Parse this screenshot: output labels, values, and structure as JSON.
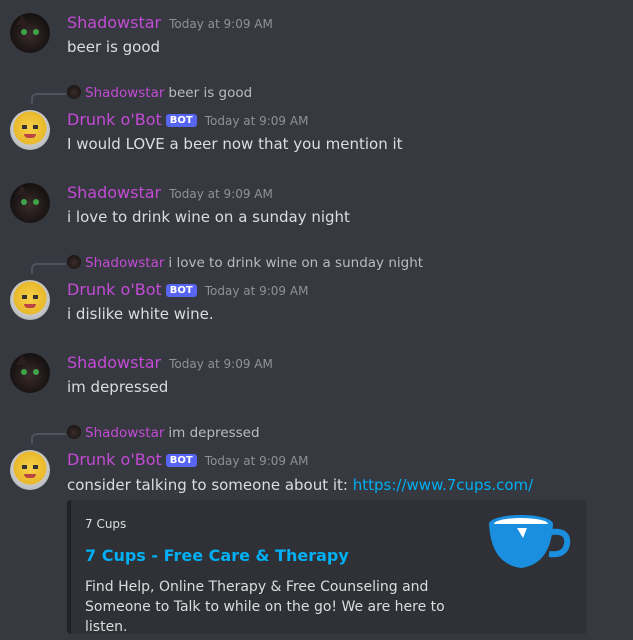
{
  "messages": [
    {
      "author": "Shadowstar",
      "timestamp": "Today at 9:09 AM",
      "text": "beer is good"
    },
    {
      "reply_to": {
        "author": "Shadowstar",
        "text": "beer is good"
      },
      "author": "Drunk o'Bot",
      "badge": "BOT",
      "timestamp": "Today at 9:09 AM",
      "text": "I would LOVE a beer now that you mention it"
    },
    {
      "author": "Shadowstar",
      "timestamp": "Today at 9:09 AM",
      "text": "i love to drink wine on a sunday night"
    },
    {
      "reply_to": {
        "author": "Shadowstar",
        "text": "i love to drink wine on a sunday night"
      },
      "author": "Drunk o'Bot",
      "badge": "BOT",
      "timestamp": "Today at 9:09 AM",
      "text": "i dislike white wine."
    },
    {
      "author": "Shadowstar",
      "timestamp": "Today at 9:09 AM",
      "text": "im depressed"
    },
    {
      "reply_to": {
        "author": "Shadowstar",
        "text": "im depressed"
      },
      "author": "Drunk o'Bot",
      "badge": "BOT",
      "timestamp": "Today at 9:09 AM",
      "text": "consider talking to someone about it:",
      "link": "https://www.7cups.com/"
    }
  ],
  "embed": {
    "provider": "7 Cups",
    "title": "7 Cups - Free Care & Therapy",
    "description": "Find Help, Online Therapy & Free Counseling and Someone to Talk to while on the go! We are here to listen.",
    "thumbnail_icon": "blue-cup-icon"
  },
  "colors": {
    "background": "#36393f",
    "username": "#c44bd6",
    "bot_badge": "#5865f2",
    "link": "#00aff4",
    "embed_bg": "#2f3136"
  }
}
